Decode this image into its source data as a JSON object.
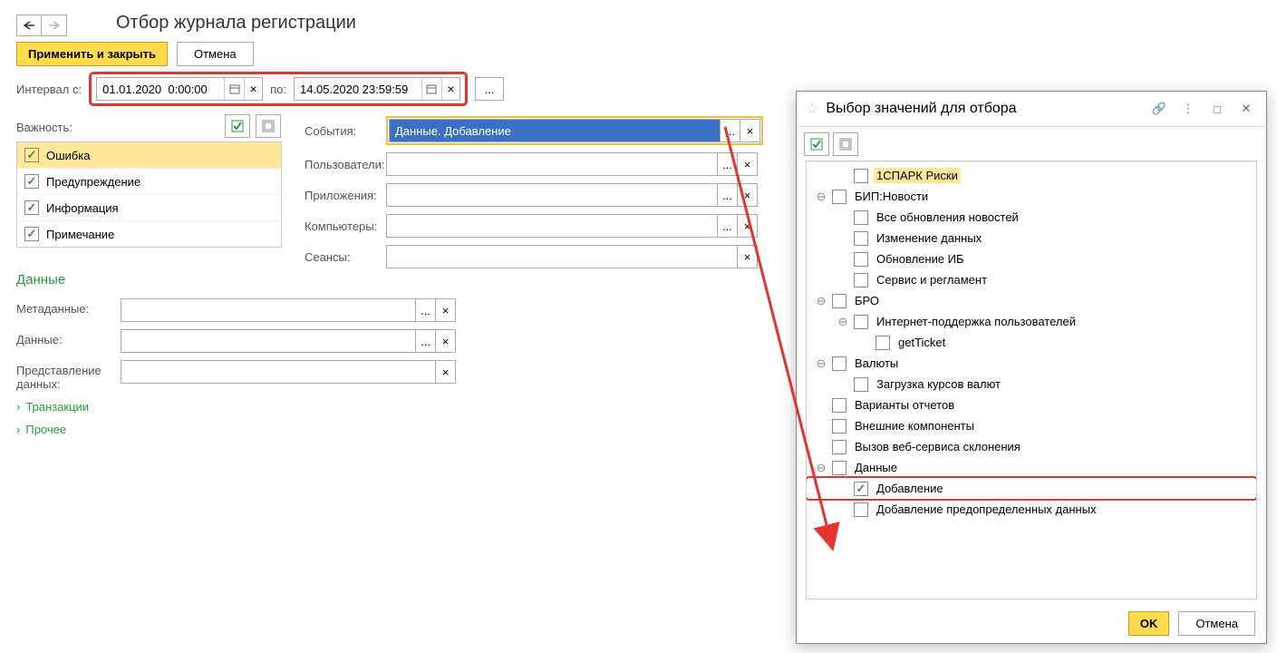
{
  "header": {
    "title": "Отбор журнала регистрации"
  },
  "buttons": {
    "apply": "Применить и закрыть",
    "cancel": "Отмена",
    "ok": "OK",
    "cancel2": "Отмена"
  },
  "interval": {
    "label": "Интервал с:",
    "from": "01.01.2020  0:00:00",
    "to_label": "по:",
    "to": "14.05.2020 23:59:59"
  },
  "importance": {
    "label": "Важность:",
    "items": [
      "Ошибка",
      "Предупреждение",
      "Информация",
      "Примечание"
    ]
  },
  "fields": {
    "events": {
      "label": "События:",
      "value": "Данные. Добавление"
    },
    "users": {
      "label": "Пользователи:",
      "value": ""
    },
    "apps": {
      "label": "Приложения:",
      "value": ""
    },
    "computers": {
      "label": "Компьютеры:",
      "value": ""
    },
    "sessions": {
      "label": "Сеансы:",
      "value": ""
    }
  },
  "data_section": {
    "title": "Данные",
    "metadata": "Метаданные:",
    "data": "Данные:",
    "repr": "Представление данных:",
    "transactions": "Транзакции",
    "other": "Прочее"
  },
  "popup": {
    "title": "Выбор значений для отбора",
    "tree": [
      {
        "indent": 1,
        "toggle": "",
        "checked": false,
        "label": "1СПАРК Риски",
        "hl": true
      },
      {
        "indent": 0,
        "toggle": "⊖",
        "checked": false,
        "label": "БИП:Новости"
      },
      {
        "indent": 1,
        "toggle": "",
        "checked": false,
        "label": "Все обновления новостей"
      },
      {
        "indent": 1,
        "toggle": "",
        "checked": false,
        "label": "Изменение данных"
      },
      {
        "indent": 1,
        "toggle": "",
        "checked": false,
        "label": "Обновление ИБ"
      },
      {
        "indent": 1,
        "toggle": "",
        "checked": false,
        "label": "Сервис и регламент"
      },
      {
        "indent": 0,
        "toggle": "⊖",
        "checked": false,
        "label": "БРО"
      },
      {
        "indent": 1,
        "toggle": "⊖",
        "checked": false,
        "label": "Интернет-поддержка пользователей"
      },
      {
        "indent": 2,
        "toggle": "",
        "checked": false,
        "label": "getTicket"
      },
      {
        "indent": 0,
        "toggle": "⊖",
        "checked": false,
        "label": "Валюты"
      },
      {
        "indent": 1,
        "toggle": "",
        "checked": false,
        "label": "Загрузка курсов валют"
      },
      {
        "indent": 0,
        "toggle": "",
        "checked": false,
        "label": "Варианты отчетов"
      },
      {
        "indent": 0,
        "toggle": "",
        "checked": false,
        "label": "Внешние компоненты"
      },
      {
        "indent": 0,
        "toggle": "",
        "checked": false,
        "label": "Вызов веб-сервиса склонения"
      },
      {
        "indent": 0,
        "toggle": "⊖",
        "checked": false,
        "label": "Данные"
      },
      {
        "indent": 1,
        "toggle": "",
        "checked": true,
        "label": "Добавление",
        "boxed": true
      },
      {
        "indent": 1,
        "toggle": "",
        "checked": false,
        "label": "Добавление предопределенных данных"
      }
    ]
  }
}
